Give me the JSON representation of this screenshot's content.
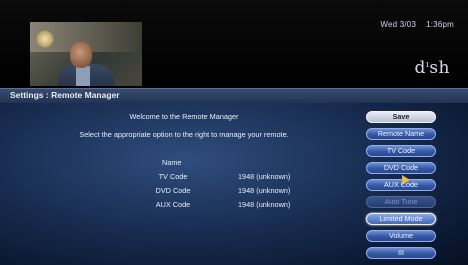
{
  "header": {
    "date": "Wed 3/03",
    "time": "1:36pm",
    "logo_text": "dish"
  },
  "title_bar": {
    "title": "Settings : Remote Manager"
  },
  "content": {
    "welcome_line": "Welcome to the Remote Manager",
    "instruction_line": "Select the appropriate option to the right to manage your remote.",
    "name_label": "Name",
    "codes": [
      {
        "label": "TV Code",
        "value": "1948 (unknown)"
      },
      {
        "label": "DVD Code",
        "value": "1948 (unknown)"
      },
      {
        "label": "AUX Code",
        "value": "1948 (unknown)"
      }
    ]
  },
  "buttons": [
    {
      "label": "Save",
      "state": "primary"
    },
    {
      "label": "Remote Name",
      "state": "normal"
    },
    {
      "label": "TV Code",
      "state": "normal"
    },
    {
      "label": "DVD Code",
      "state": "normal"
    },
    {
      "label": "AUX Code",
      "state": "normal"
    },
    {
      "label": "Auto Tune",
      "state": "disabled"
    },
    {
      "label": "Limited Mode",
      "state": "focused"
    },
    {
      "label": "Volume",
      "state": "normal"
    },
    {
      "label": "III",
      "state": "normal"
    }
  ],
  "colors": {
    "button_blue": "#3457a6",
    "background_blue": "#1a2f54",
    "pointer": "#e8c040"
  }
}
